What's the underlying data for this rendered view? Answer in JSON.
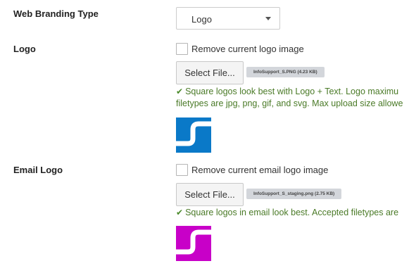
{
  "web_branding": {
    "label": "Web Branding Type",
    "select_value": "Logo"
  },
  "logo": {
    "label": "Logo",
    "remove_label": "Remove current logo image",
    "select_file_label": "Select File...",
    "file_badge": "InfoSupport_S.PNG (4.23 KB)",
    "help_line1": "Square logos look best with Logo + Text. Logo maximu",
    "help_line2": "filetypes are jpg, png, gif, and svg. Max upload size allowe",
    "thumb_color": "#0a79c8"
  },
  "email_logo": {
    "label": "Email Logo",
    "remove_label": "Remove current email logo image",
    "select_file_label": "Select File...",
    "file_badge": "InfoSupport_S_staging.png (2.75 KB)",
    "help_line1": "Square logos in email look best. Accepted filetypes are",
    "thumb_color": "#c800c8"
  },
  "icons": {
    "select_caret": "chevron-down-icon",
    "check": "checkmark-icon"
  }
}
